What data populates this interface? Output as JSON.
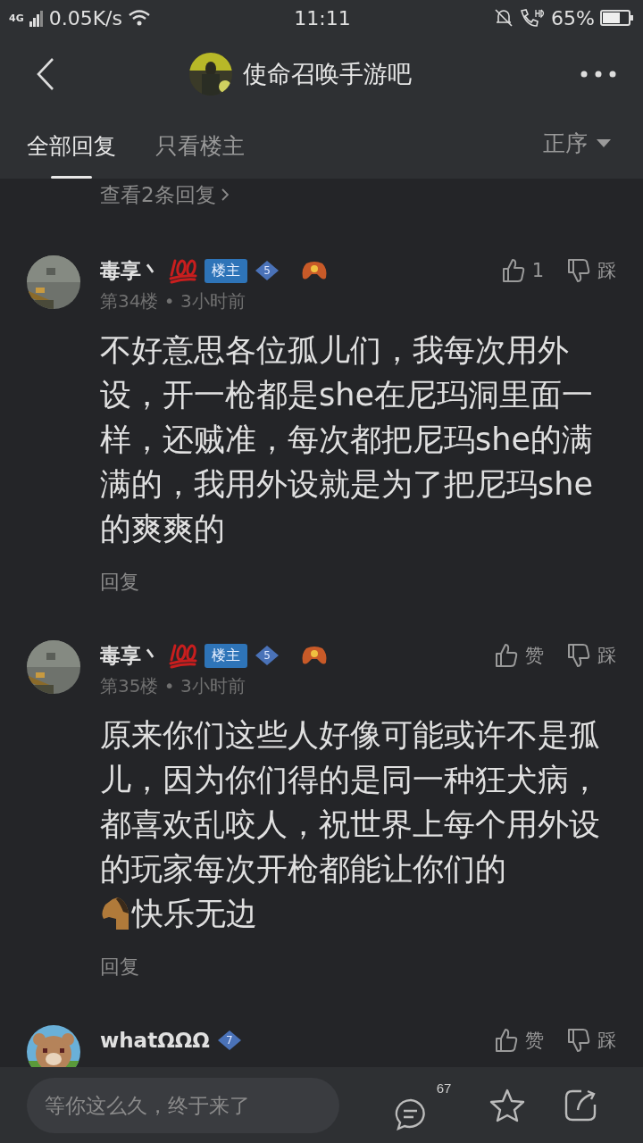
{
  "status_bar": {
    "network": "4G",
    "speed": "0.05K/s",
    "time": "11:11",
    "battery": "65%"
  },
  "header": {
    "title": "使命召唤手游吧"
  },
  "tabs": [
    {
      "label": "全部回复",
      "selected": true
    },
    {
      "label": "只看楼主",
      "selected": false
    }
  ],
  "sort": {
    "label": "正序"
  },
  "prev_replies_link": "查看2条回复",
  "posts": [
    {
      "username": "毒享丶",
      "hundred_badge": true,
      "op_badge": "楼主",
      "level": "5",
      "game_badge": true,
      "floor": "第34楼",
      "separator": "•",
      "time": "3小时前",
      "like": "1",
      "dislike": "踩",
      "content": [
        "不好意思各位孤儿们，我每次用外设，开一枪都是she在尼玛洞里面一样，还贼准，每次都把尼玛she的满满的，我用外设就是为了把尼玛she的爽爽的"
      ],
      "reply": "回复"
    },
    {
      "username": "毒享丶",
      "hundred_badge": true,
      "op_badge": "楼主",
      "level": "5",
      "game_badge": true,
      "floor": "第35楼",
      "separator": "•",
      "time": "3小时前",
      "like": "赞",
      "dislike": "踩",
      "content": [
        "原来你们这些人好像可能或许不是孤儿，因为你们得的是同一种狂犬病，都喜欢乱咬人，祝世界上每个用外设的玩家每次开枪都能让你们的",
        "快乐无边"
      ],
      "reply": "回复"
    },
    {
      "username": "whatΩΩΩ",
      "hundred_badge": false,
      "level": "7",
      "game_badge": false,
      "like": "赞",
      "dislike": "踩"
    }
  ],
  "bottom_bar": {
    "placeholder": "等你这么久，终于来了",
    "comment_count": "67"
  }
}
